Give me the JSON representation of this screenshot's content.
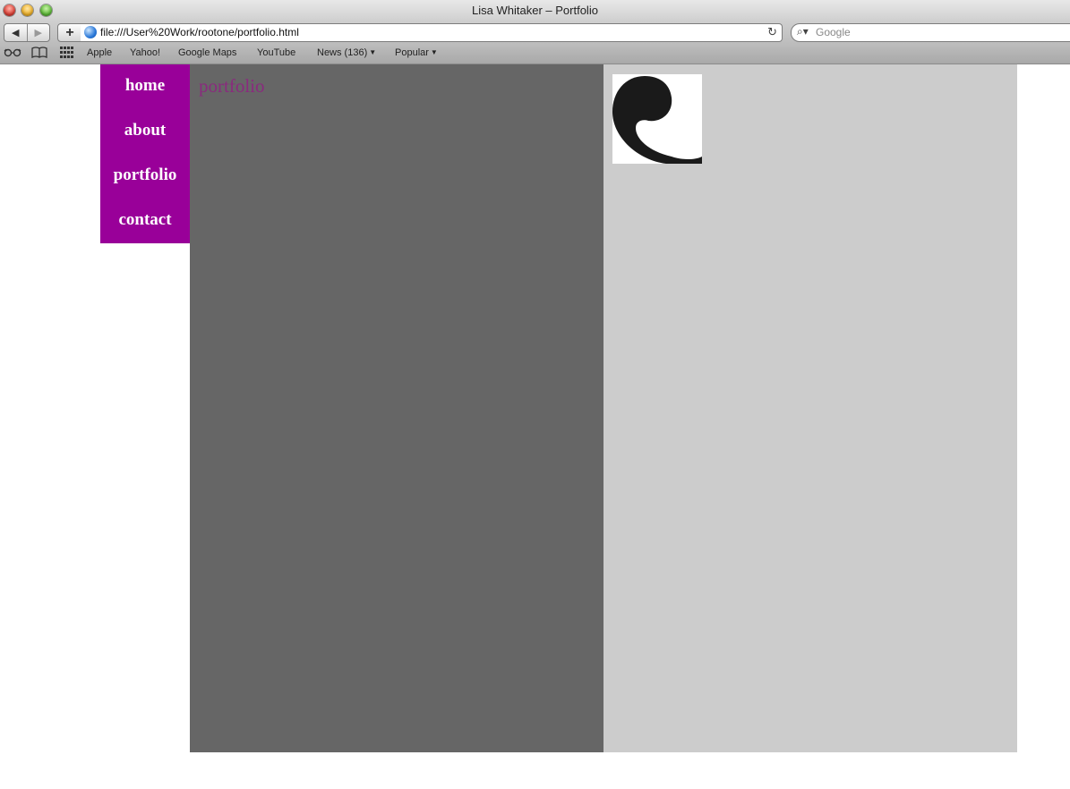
{
  "browser": {
    "window_title": "Lisa Whitaker – Portfolio",
    "url": "file:///User%20Work/rootone/portfolio.html",
    "search_placeholder": "Google",
    "bookmarks": [
      {
        "label": "Apple"
      },
      {
        "label": "Yahoo!"
      },
      {
        "label": "Google Maps"
      },
      {
        "label": "YouTube"
      },
      {
        "label": "News (136)",
        "dropdown": true
      },
      {
        "label": "Popular",
        "dropdown": true
      }
    ],
    "icons": [
      "back-arrow-icon",
      "forward-arrow-icon",
      "add-bookmark-icon",
      "globe-icon",
      "reload-icon",
      "search-icon",
      "reading-glasses-icon",
      "book-icon",
      "top-sites-grid-icon"
    ]
  },
  "nav": {
    "items": [
      {
        "label": "home"
      },
      {
        "label": "about"
      },
      {
        "label": "portfolio"
      },
      {
        "label": "contact"
      }
    ]
  },
  "main": {
    "section_title": "portfolio"
  },
  "colors": {
    "nav_bg": "#990099",
    "nav_text": "#ffffff",
    "title_color": "#8a2a7e",
    "left_column": "#666666",
    "right_column": "#cccccc"
  }
}
